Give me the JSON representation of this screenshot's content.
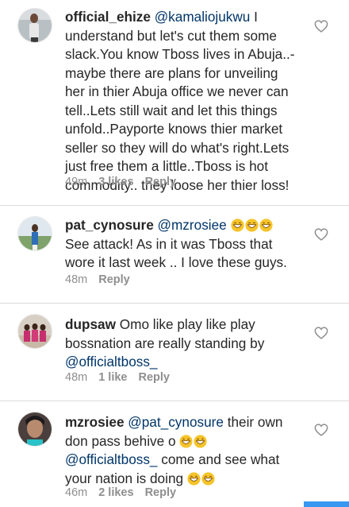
{
  "comments": [
    {
      "username": "official_ehize",
      "mention": "@kamaliojukwu",
      "text": " I understand but let's cut them some slack.You know Tboss lives in Abuja..- maybe there are plans for unveiling her in thier Abuja office we never can tell..Lets still wait and let this things unfold..Payporte knows thier market seller so they will do what's right.Lets just free them a little..Tboss is hot commodity.. they loose her thier loss!",
      "time": "49m",
      "likes": "3 likes",
      "reply": "Reply"
    },
    {
      "username": "pat_cynosure",
      "mention": "@mzrosiee",
      "text_after_emoji": " See attack!  As in it was Tboss that wore it last week .. I love these guys.",
      "time": "48m",
      "reply": "Reply"
    },
    {
      "username": "dupsaw",
      "text": " Omo like play like play bossnation are really standing by",
      "mention": "@officialtboss_",
      "time": "48m",
      "likes": "1 like",
      "reply": "Reply"
    },
    {
      "username": "mzrosiee",
      "mention": "@pat_cynosure",
      "text": " their own don pass behive o",
      "mention2": "@officialtboss_",
      "text2": " come and see what your nation is doing",
      "time": "46m",
      "likes": "2 likes",
      "reply": "Reply"
    }
  ],
  "icons": {
    "like": "heart-icon",
    "emoji": "grinning-face-emoji"
  },
  "colors": {
    "mention": "#003569",
    "meta": "#8e8e8e",
    "accent": "#3897f0"
  }
}
